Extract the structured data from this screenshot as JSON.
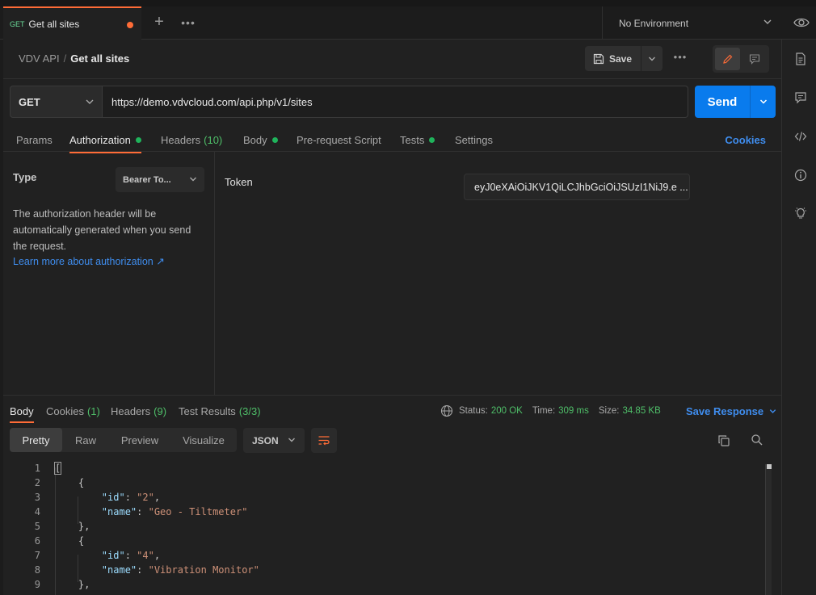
{
  "tab": {
    "method": "GET",
    "name": "Get all sites"
  },
  "environment": {
    "selected": "No Environment"
  },
  "breadcrumb": {
    "collection": "VDV API",
    "separator": "/",
    "request": "Get all sites"
  },
  "toolbar": {
    "save_label": "Save"
  },
  "request": {
    "method": "GET",
    "url": "https://demo.vdvcloud.com/api.php/v1/sites",
    "send_label": "Send"
  },
  "request_tabs": [
    {
      "label": "Params"
    },
    {
      "label": "Authorization",
      "dot": true
    },
    {
      "label": "Headers",
      "count": "(10)"
    },
    {
      "label": "Body",
      "dot": true
    },
    {
      "label": "Pre-request Script"
    },
    {
      "label": "Tests",
      "dot": true
    },
    {
      "label": "Settings"
    }
  ],
  "cookies_label": "Cookies",
  "auth": {
    "type_label": "Type",
    "type_value": "Bearer To...",
    "description": "The authorization header will be automatically generated when you send the request.",
    "learn_more": "Learn more about authorization ↗",
    "token_label": "Token",
    "token_value": "eyJ0eXAiOiJKV1QiLCJhbGciOiJSUzI1NiJ9.e ..."
  },
  "response_tabs": [
    {
      "label": "Body"
    },
    {
      "label": "Cookies",
      "count": "(1)"
    },
    {
      "label": "Headers",
      "count": "(9)"
    },
    {
      "label": "Test Results",
      "count": "(3/3)"
    }
  ],
  "status": {
    "status_label": "Status:",
    "status_value": "200 OK",
    "time_label": "Time:",
    "time_value": "309 ms",
    "size_label": "Size:",
    "size_value": "34.85 KB"
  },
  "save_response_label": "Save Response",
  "view_modes": [
    "Pretty",
    "Raw",
    "Preview",
    "Visualize"
  ],
  "format": "JSON",
  "code_lines": [
    {
      "n": "1",
      "text": "["
    },
    {
      "n": "2",
      "text": "    {"
    },
    {
      "n": "3",
      "key": "\"id\"",
      "val": "\"2\"",
      "tail": ","
    },
    {
      "n": "4",
      "key": "\"name\"",
      "val": "\"Geo - Tiltmeter\"",
      "tail": ""
    },
    {
      "n": "5",
      "text": "    },"
    },
    {
      "n": "6",
      "text": "    {"
    },
    {
      "n": "7",
      "key": "\"id\"",
      "val": "\"4\"",
      "tail": ","
    },
    {
      "n": "8",
      "key": "\"name\"",
      "val": "\"Vibration Monitor\"",
      "tail": ""
    },
    {
      "n": "9",
      "text": "    },"
    }
  ],
  "colors": {
    "accent": "#ff6c37",
    "send": "#097bed",
    "success": "#4fbf69",
    "link": "#3f8dee"
  }
}
